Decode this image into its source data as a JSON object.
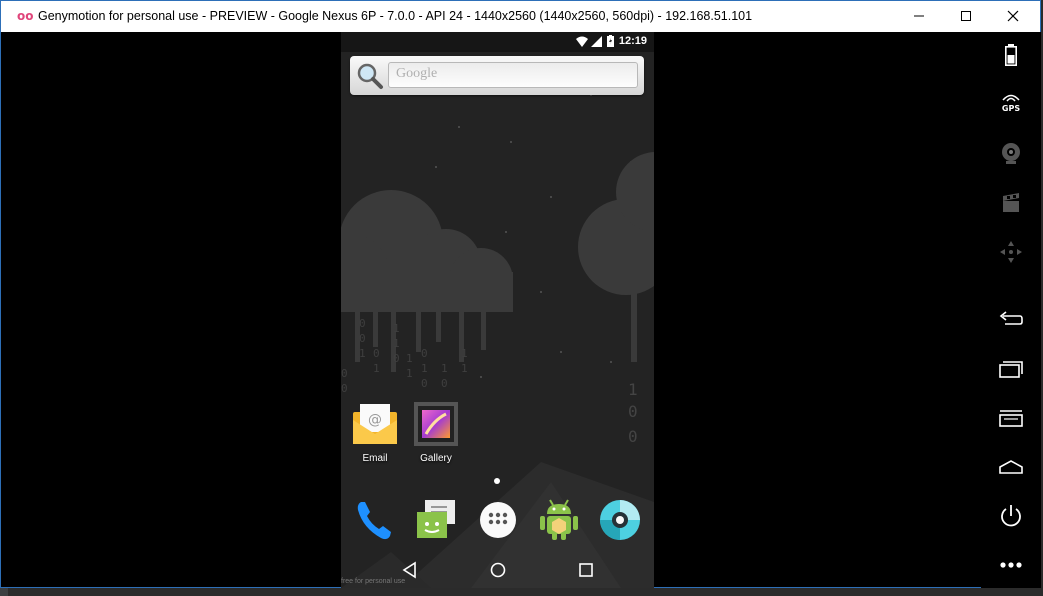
{
  "window": {
    "title": "Genymotion for personal use - PREVIEW - Google Nexus 6P - 7.0.0 - API 24 - 1440x2560 (1440x2560, 560dpi) - 192.168.51.101",
    "logo": "oo"
  },
  "toolbar": {
    "items": [
      {
        "name": "battery-icon"
      },
      {
        "name": "gps-icon",
        "label": "GPS"
      },
      {
        "name": "webcam-icon"
      },
      {
        "name": "media-icon"
      },
      {
        "name": "dpad-icon"
      },
      {
        "name": "back-icon"
      },
      {
        "name": "recent-apps-icon"
      },
      {
        "name": "menu-icon"
      },
      {
        "name": "home-icon"
      },
      {
        "name": "power-icon"
      },
      {
        "name": "more-icon"
      }
    ]
  },
  "phone": {
    "status": {
      "time": "12:19"
    },
    "search": {
      "placeholder": "Google"
    },
    "apps": [
      {
        "label": "Email",
        "icon": "email-icon"
      },
      {
        "label": "Gallery",
        "icon": "gallery-icon"
      }
    ],
    "dock": [
      {
        "icon": "phone-icon"
      },
      {
        "icon": "messaging-icon"
      },
      {
        "icon": "app-drawer-icon"
      },
      {
        "icon": "api-demos-icon"
      },
      {
        "icon": "camera-icon"
      }
    ],
    "watermark": "free for personal use",
    "colors": {
      "accent": "#2d6fb8",
      "wallpaper": "#222222",
      "title_logo": "#e0457b"
    }
  }
}
